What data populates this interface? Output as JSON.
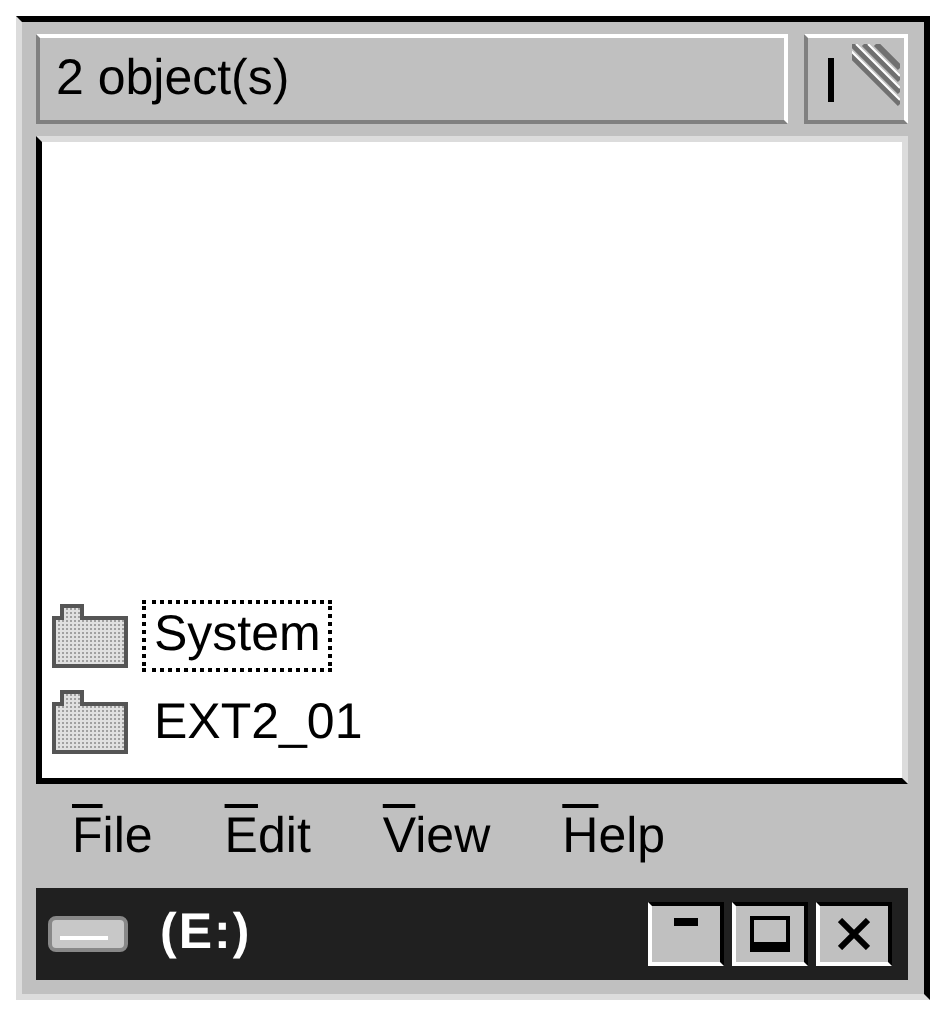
{
  "status_bar": {
    "text": "2 object(s)"
  },
  "items": [
    {
      "label": "System",
      "focused": true
    },
    {
      "label": "EXT2_01",
      "focused": false
    }
  ],
  "menu": [
    {
      "accelerator": "F",
      "rest": "ile"
    },
    {
      "accelerator": "E",
      "rest": "dit"
    },
    {
      "accelerator": "V",
      "rest": "iew"
    },
    {
      "accelerator": "H",
      "rest": "elp"
    }
  ],
  "window": {
    "title": "(E:)"
  },
  "title_buttons": [
    {
      "kind": "minimize"
    },
    {
      "kind": "maximize"
    },
    {
      "kind": "close"
    }
  ]
}
